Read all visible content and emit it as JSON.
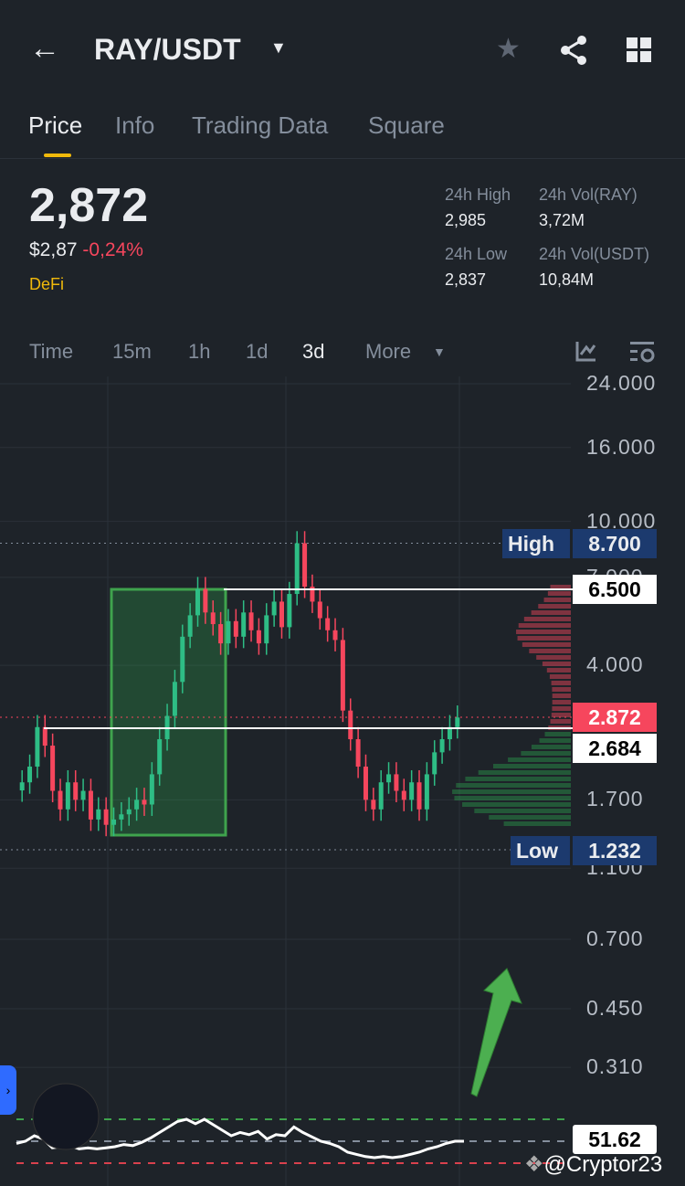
{
  "header": {
    "pair": "RAY/USDT"
  },
  "tabs": [
    "Price",
    "Info",
    "Trading Data",
    "Square"
  ],
  "ticker": {
    "last": "2,872",
    "usd": "$2,87",
    "change": "-0,24%",
    "tag": "DeFi",
    "stats": [
      {
        "label": "24h High",
        "value": "2,985"
      },
      {
        "label": "24h Vol(RAY)",
        "value": "3,72M"
      },
      {
        "label": "24h Low",
        "value": "2,837"
      },
      {
        "label": "24h Vol(USDT)",
        "value": "10,84M"
      }
    ]
  },
  "intervals": [
    "Time",
    "15m",
    "1h",
    "1d",
    "3d",
    "More"
  ],
  "chart_data": {
    "type": "candlestick",
    "yscale": "log",
    "y_ticks": [
      "24.000",
      "16.000",
      "10.000",
      "7.000",
      "4.000",
      "1.700",
      "1.100",
      "0.700",
      "0.450",
      "0.310"
    ],
    "y_tick_values": [
      24,
      16,
      10,
      7,
      4,
      1.7,
      1.1,
      0.7,
      0.45,
      0.31
    ],
    "closes": [
      1.9,
      2.1,
      2.7,
      2.4,
      1.8,
      1.6,
      1.9,
      1.7,
      1.8,
      1.5,
      1.6,
      1.45,
      1.5,
      1.55,
      1.6,
      1.7,
      1.65,
      2.0,
      2.5,
      2.9,
      3.6,
      4.8,
      5.5,
      6.5,
      5.6,
      5.2,
      4.6,
      5.3,
      4.8,
      5.6,
      5.0,
      4.6,
      5.5,
      6.0,
      5.1,
      6.3,
      8.7,
      6.6,
      6.0,
      5.4,
      5.0,
      4.7,
      3.0,
      2.5,
      2.1,
      1.7,
      1.6,
      1.9,
      2.0,
      1.8,
      1.7,
      1.9,
      1.6,
      2.0,
      2.3,
      2.5,
      2.7,
      2.87
    ],
    "high": {
      "label": "High",
      "value": "8.700"
    },
    "low": {
      "label": "Low",
      "value": "1.232"
    },
    "levels": [
      {
        "value": "6.500"
      },
      {
        "value": "2.684"
      }
    ],
    "current": "2.872",
    "rsi": {
      "value": "51.62",
      "series": [
        48,
        50,
        55,
        52,
        44,
        45,
        46,
        43,
        44,
        43,
        44,
        45,
        47,
        46,
        49,
        53,
        58,
        63,
        68,
        70,
        66,
        70,
        65,
        60,
        55,
        58,
        56,
        59,
        52,
        56,
        55,
        63,
        58,
        54,
        50,
        48,
        45,
        40,
        38,
        36,
        35,
        36,
        35,
        36,
        38,
        40,
        43,
        45,
        48,
        50,
        50
      ]
    }
  },
  "watermark": "@Cryptor23",
  "colors": {
    "up": "#2ebd85",
    "down": "#f6465d",
    "accent": "#f0b90b"
  }
}
